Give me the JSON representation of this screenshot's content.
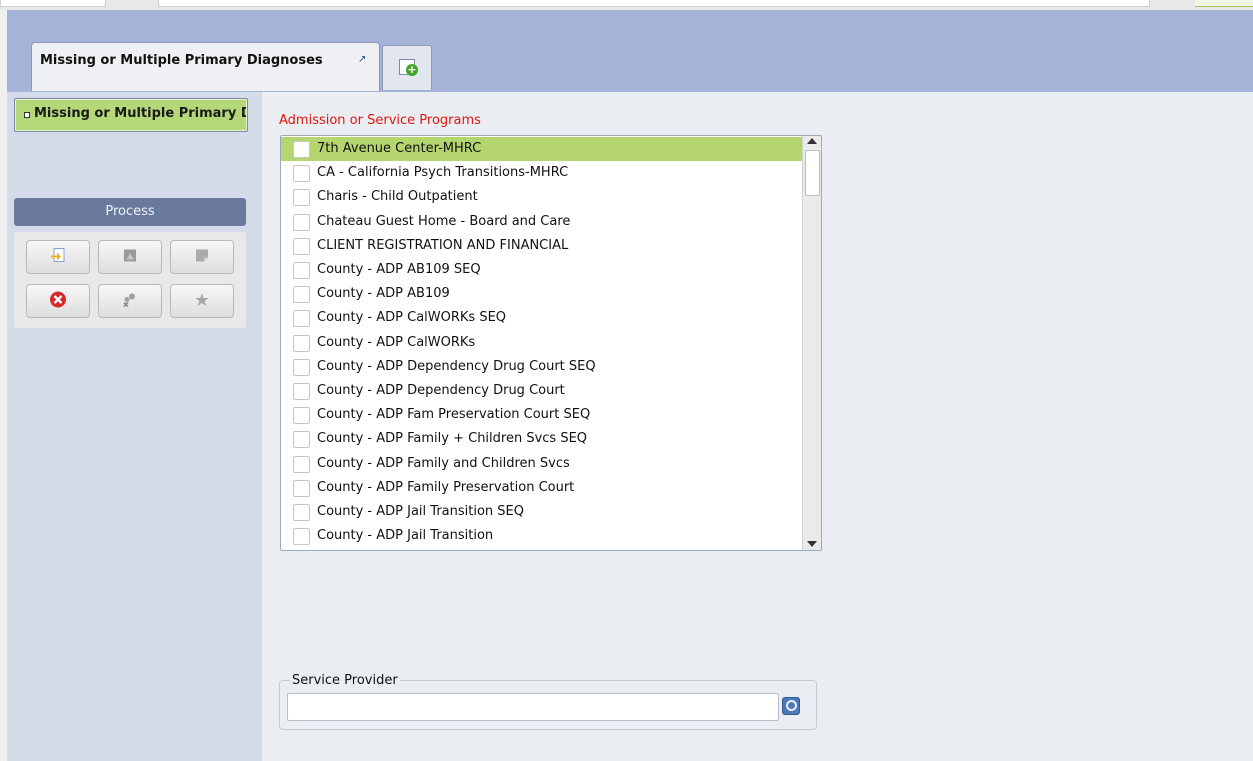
{
  "tabs": {
    "active_label": "Missing or Multiple Primary Diagnoses",
    "pin_icon": "pin-icon",
    "add_icon": "new-tab-plus-icon"
  },
  "sidebar": {
    "item_label": "Missing or Multiple Primary Diagnoses",
    "process_label": "Process",
    "buttons": [
      {
        "icon": "open-document-icon"
      },
      {
        "icon": "image-icon"
      },
      {
        "icon": "note-icon"
      },
      {
        "icon": "close-red-icon"
      },
      {
        "icon": "tools-icon"
      },
      {
        "icon": "star-icon"
      }
    ]
  },
  "main": {
    "programs_label": "Admission or Service Programs",
    "programs": [
      {
        "label": "7th Avenue Center-MHRC",
        "selected": true
      },
      {
        "label": "CA - California Psych Transitions-MHRC"
      },
      {
        "label": "Charis - Child Outpatient"
      },
      {
        "label": "Chateau Guest Home - Board and Care"
      },
      {
        "label": "CLIENT REGISTRATION AND FINANCIAL"
      },
      {
        "label": "County - ADP AB109 SEQ"
      },
      {
        "label": "County - ADP AB109"
      },
      {
        "label": "County - ADP CalWORKs SEQ"
      },
      {
        "label": "County - ADP CalWORKs"
      },
      {
        "label": "County - ADP Dependency Drug Court SEQ"
      },
      {
        "label": "County - ADP Dependency Drug Court"
      },
      {
        "label": "County - ADP Fam Preservation Court SEQ"
      },
      {
        "label": "County - ADP Family + Children Svcs SEQ"
      },
      {
        "label": "County - ADP Family and Children Svcs"
      },
      {
        "label": "County - ADP Family Preservation Court"
      },
      {
        "label": "County - ADP Jail Transition SEQ"
      },
      {
        "label": "County - ADP Jail Transition"
      }
    ],
    "service_provider": {
      "legend": "Service Provider",
      "value": "",
      "search_icon": "search-icon"
    }
  },
  "colors": {
    "selected_row": "#b5d66f",
    "sidebar_item": "#b4d878",
    "process_bar": "#6a7a9c",
    "header_blue": "#a4b3d8",
    "required_label": "#e5140e"
  }
}
